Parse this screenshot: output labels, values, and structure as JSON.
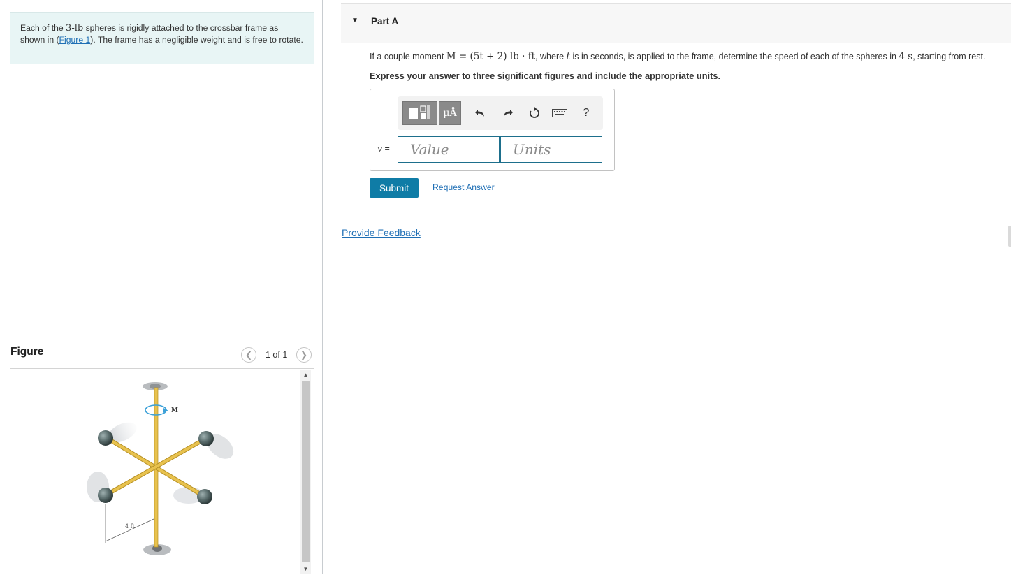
{
  "problem": {
    "text_before": "Each of the ",
    "weight": "3-lb",
    "text_mid": " spheres is rigidly attached to the crossbar frame as shown in (",
    "figure_link": "Figure 1",
    "text_after": "). The frame has a negligible weight and is free to rotate."
  },
  "figure_panel": {
    "title": "Figure",
    "count": "1 of 1",
    "labels": {
      "moment": "M",
      "dimension": "4 ft"
    }
  },
  "part": {
    "title": "Part A",
    "question_pre": "If a couple moment ",
    "question_eq": "M = (5t + 2) lb · ft",
    "question_mid1": ", where ",
    "question_var": "t",
    "question_mid2": " is in seconds, is applied to the frame, determine the speed of each of the spheres in ",
    "question_time": "4 s",
    "question_post": ", starting from rest.",
    "instruction": "Express your answer to three significant figures and include the appropriate units."
  },
  "answer": {
    "variable": "v",
    "equals": "=",
    "value_placeholder": "Value",
    "units_placeholder": "Units",
    "unit_button_label": "μÅ",
    "help_label": "?"
  },
  "buttons": {
    "submit": "Submit",
    "request_answer": "Request Answer",
    "provide_feedback": "Provide Feedback"
  },
  "icons": [
    "caret-down-icon",
    "templates-icon",
    "units-icon",
    "undo-icon",
    "redo-icon",
    "reset-icon",
    "keyboard-icon",
    "help-icon",
    "chevron-left-icon",
    "chevron-right-icon"
  ],
  "colors": {
    "accent": "#0f7ca6",
    "link": "#1f6fb5",
    "problem_bg": "#e8f5f5",
    "frame": "#e8c24e"
  }
}
